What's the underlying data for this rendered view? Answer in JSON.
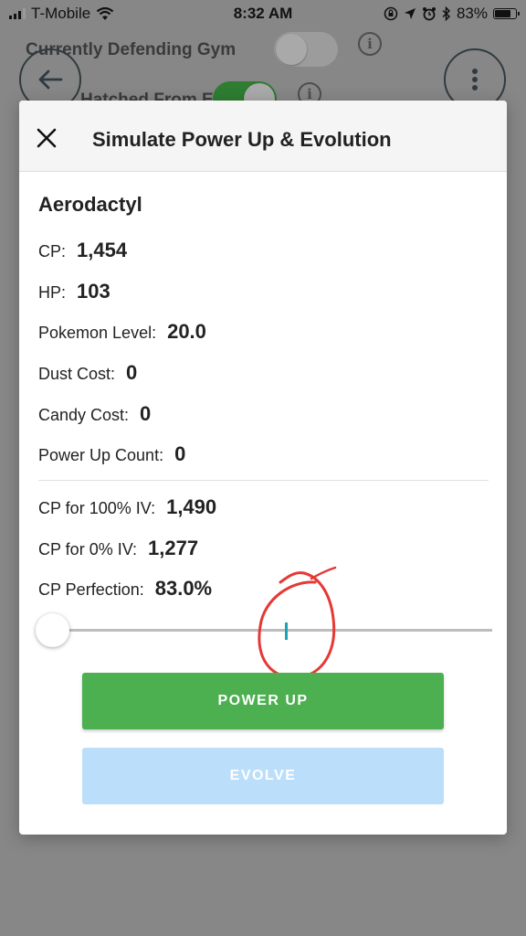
{
  "status_bar": {
    "carrier": "T-Mobile",
    "time": "8:32 AM",
    "battery_percent": "83%",
    "battery_level": 0.83
  },
  "background": {
    "gym_label": "Currently Defending Gym",
    "egg_label": "Hatched From Egg",
    "gym_toggle_on": false,
    "egg_toggle_on": true,
    "info_glyph": "i"
  },
  "modal": {
    "title": "Simulate Power Up & Evolution",
    "pokemon_name": "Aerodactyl",
    "stats": {
      "cp": {
        "label": "CP:",
        "value": "1,454"
      },
      "hp": {
        "label": "HP:",
        "value": "103"
      },
      "level": {
        "label": "Pokemon Level:",
        "value": "20.0"
      },
      "dust": {
        "label": "Dust Cost:",
        "value": "0"
      },
      "candy": {
        "label": "Candy Cost:",
        "value": "0"
      },
      "powerup_count": {
        "label": "Power Up Count:",
        "value": "0"
      }
    },
    "iv_stats": {
      "cp_100": {
        "label": "CP for 100% IV:",
        "value": "1,490"
      },
      "cp_0": {
        "label": "CP for 0% IV:",
        "value": "1,277"
      },
      "perfection": {
        "label": "CP Perfection:",
        "value": "83.0%"
      }
    },
    "slider": {
      "value_fraction": 0.0,
      "marker_fraction": 0.53
    },
    "power_up_label": "POWER UP",
    "evolve_label": "EVOLVE"
  },
  "colors": {
    "backdrop": "#878787",
    "toggle_on": "#2e7d32",
    "power_up": "#4caf50",
    "evolve_disabled": "#bbdefb",
    "slider_marker": "#1aa3b5",
    "annotation": "#e53935"
  },
  "icons": {
    "close": "close-icon",
    "back": "arrow-left-icon",
    "more": "more-vertical-icon",
    "wifi": "wifi-icon",
    "bluetooth": "bluetooth-icon",
    "alarm": "alarm-icon",
    "location": "location-arrow-icon",
    "lock_rotation": "rotation-lock-icon"
  }
}
